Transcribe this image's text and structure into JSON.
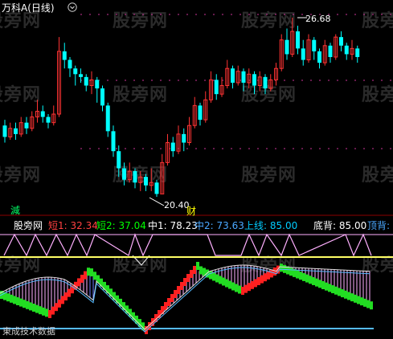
{
  "header": {
    "title": "万科A(日线)",
    "chevron_icon": "chevron-down-icon"
  },
  "watermark": {
    "text": "股旁网"
  },
  "price_chart": {
    "high_label": "26.68",
    "low_label": "20.40",
    "low_marker_text": "财",
    "bottom_left_marker": "減",
    "up_color": "#ff3333",
    "down_color": "#00ffff",
    "candles": [
      {
        "o": 22.9,
        "c": 22.5,
        "h": 23.1,
        "l": 22.3
      },
      {
        "o": 22.5,
        "c": 22.8,
        "h": 23.0,
        "l": 22.4
      },
      {
        "o": 22.8,
        "c": 22.6,
        "h": 23.0,
        "l": 22.4
      },
      {
        "o": 22.6,
        "c": 23.0,
        "h": 23.2,
        "l": 22.5
      },
      {
        "o": 23.0,
        "c": 22.8,
        "h": 23.2,
        "l": 22.6
      },
      {
        "o": 22.8,
        "c": 23.2,
        "h": 23.4,
        "l": 22.7
      },
      {
        "o": 23.2,
        "c": 23.4,
        "h": 23.8,
        "l": 23.0
      },
      {
        "o": 23.4,
        "c": 23.2,
        "h": 23.6,
        "l": 23.0
      },
      {
        "o": 23.2,
        "c": 23.0,
        "h": 23.3,
        "l": 22.8
      },
      {
        "o": 23.0,
        "c": 23.3,
        "h": 23.6,
        "l": 22.9
      },
      {
        "o": 23.3,
        "c": 25.5,
        "h": 26.0,
        "l": 23.2
      },
      {
        "o": 25.5,
        "c": 25.2,
        "h": 25.8,
        "l": 24.9
      },
      {
        "o": 25.2,
        "c": 24.9,
        "h": 25.3,
        "l": 24.6
      },
      {
        "o": 24.9,
        "c": 24.7,
        "h": 25.0,
        "l": 24.3
      },
      {
        "o": 24.7,
        "c": 24.6,
        "h": 24.9,
        "l": 24.4
      },
      {
        "o": 24.6,
        "c": 24.3,
        "h": 24.7,
        "l": 24.1
      },
      {
        "o": 24.3,
        "c": 24.5,
        "h": 24.8,
        "l": 24.0
      },
      {
        "o": 24.5,
        "c": 24.2,
        "h": 24.6,
        "l": 23.7
      },
      {
        "o": 24.2,
        "c": 23.6,
        "h": 24.3,
        "l": 23.4
      },
      {
        "o": 23.6,
        "c": 22.7,
        "h": 23.7,
        "l": 22.5
      },
      {
        "o": 22.7,
        "c": 22.0,
        "h": 22.9,
        "l": 21.8
      },
      {
        "o": 22.0,
        "c": 21.4,
        "h": 22.2,
        "l": 21.1
      },
      {
        "o": 21.4,
        "c": 21.0,
        "h": 21.6,
        "l": 20.8
      },
      {
        "o": 21.0,
        "c": 21.3,
        "h": 21.6,
        "l": 20.9
      },
      {
        "o": 21.3,
        "c": 20.9,
        "h": 21.4,
        "l": 20.7
      },
      {
        "o": 20.9,
        "c": 21.1,
        "h": 21.3,
        "l": 20.6
      },
      {
        "o": 21.1,
        "c": 20.8,
        "h": 21.2,
        "l": 20.6
      },
      {
        "o": 20.8,
        "c": 20.9,
        "h": 21.4,
        "l": 20.6
      },
      {
        "o": 20.9,
        "c": 20.5,
        "h": 21.0,
        "l": 20.4
      },
      {
        "o": 20.5,
        "c": 21.6,
        "h": 21.9,
        "l": 20.5
      },
      {
        "o": 21.6,
        "c": 22.3,
        "h": 22.6,
        "l": 21.5
      },
      {
        "o": 22.3,
        "c": 22.0,
        "h": 22.5,
        "l": 21.8
      },
      {
        "o": 22.0,
        "c": 22.6,
        "h": 22.9,
        "l": 21.9
      },
      {
        "o": 22.6,
        "c": 22.3,
        "h": 22.8,
        "l": 22.0
      },
      {
        "o": 22.3,
        "c": 22.9,
        "h": 23.2,
        "l": 22.2
      },
      {
        "o": 22.9,
        "c": 23.6,
        "h": 23.9,
        "l": 22.8
      },
      {
        "o": 23.6,
        "c": 23.1,
        "h": 23.7,
        "l": 22.9
      },
      {
        "o": 23.1,
        "c": 23.8,
        "h": 24.1,
        "l": 23.0
      },
      {
        "o": 23.8,
        "c": 24.5,
        "h": 24.8,
        "l": 23.7
      },
      {
        "o": 24.5,
        "c": 24.0,
        "h": 24.7,
        "l": 23.8
      },
      {
        "o": 24.0,
        "c": 24.3,
        "h": 24.6,
        "l": 23.9
      },
      {
        "o": 24.3,
        "c": 24.9,
        "h": 25.2,
        "l": 24.2
      },
      {
        "o": 24.9,
        "c": 24.4,
        "h": 25.0,
        "l": 24.2
      },
      {
        "o": 24.4,
        "c": 24.8,
        "h": 25.0,
        "l": 24.3
      },
      {
        "o": 24.8,
        "c": 24.4,
        "h": 24.9,
        "l": 24.1
      },
      {
        "o": 24.4,
        "c": 24.7,
        "h": 24.9,
        "l": 24.2
      },
      {
        "o": 24.7,
        "c": 24.3,
        "h": 24.8,
        "l": 24.0
      },
      {
        "o": 24.3,
        "c": 24.6,
        "h": 24.8,
        "l": 24.1
      },
      {
        "o": 24.6,
        "c": 24.2,
        "h": 24.7,
        "l": 24.0
      },
      {
        "o": 24.2,
        "c": 24.5,
        "h": 24.7,
        "l": 24.1
      },
      {
        "o": 24.5,
        "c": 24.9,
        "h": 25.1,
        "l": 24.3
      },
      {
        "o": 24.9,
        "c": 25.9,
        "h": 26.1,
        "l": 24.8
      },
      {
        "o": 25.9,
        "c": 25.4,
        "h": 26.3,
        "l": 25.2
      },
      {
        "o": 25.4,
        "c": 26.2,
        "h": 26.68,
        "l": 25.3
      },
      {
        "o": 26.2,
        "c": 25.6,
        "h": 26.4,
        "l": 25.4
      },
      {
        "o": 25.6,
        "c": 25.2,
        "h": 25.9,
        "l": 25.0
      },
      {
        "o": 25.2,
        "c": 25.9,
        "h": 26.1,
        "l": 25.1
      },
      {
        "o": 25.9,
        "c": 25.5,
        "h": 26.0,
        "l": 25.2
      },
      {
        "o": 25.5,
        "c": 25.1,
        "h": 25.6,
        "l": 24.9
      },
      {
        "o": 25.1,
        "c": 25.7,
        "h": 25.9,
        "l": 25.0
      },
      {
        "o": 25.7,
        "c": 25.3,
        "h": 25.8,
        "l": 25.1
      },
      {
        "o": 25.3,
        "c": 26.0,
        "h": 26.1,
        "l": 25.2
      },
      {
        "o": 26.0,
        "c": 25.7,
        "h": 26.2,
        "l": 25.5
      },
      {
        "o": 25.7,
        "c": 25.4,
        "h": 25.8,
        "l": 25.2
      },
      {
        "o": 25.4,
        "c": 25.6,
        "h": 25.9,
        "l": 25.2
      },
      {
        "o": 25.6,
        "c": 25.3,
        "h": 25.7,
        "l": 25.1
      }
    ]
  },
  "indicator": {
    "name": "股旁网",
    "items": [
      {
        "label": "短1",
        "value": "32.34",
        "color": "#ff4040"
      },
      {
        "label": "短2",
        "value": "37.04",
        "color": "#00ff00"
      },
      {
        "label": "中1",
        "value": "78.23",
        "color": "#ffffff"
      },
      {
        "label": "中2",
        "value": "73.63",
        "color": "#4aa8ff"
      },
      {
        "label": "上线",
        "value": "85.00",
        "color": "#00ccff"
      },
      {
        "label": "底背",
        "value": "85.00",
        "color": "#ffffff"
      },
      {
        "label": "顶背",
        "value": "",
        "color": "#4aa8ff"
      }
    ],
    "footer": "東成技术数据"
  },
  "lower_chart": {
    "colors": {
      "red": "#ff2020",
      "green": "#22dd22",
      "blue_hatch": "#6d7cff",
      "pink_hatch": "#ffb0ff",
      "yellow_line": "#ffff66",
      "cyan_line": "#55bbff",
      "white_line": "#dddddd"
    }
  }
}
